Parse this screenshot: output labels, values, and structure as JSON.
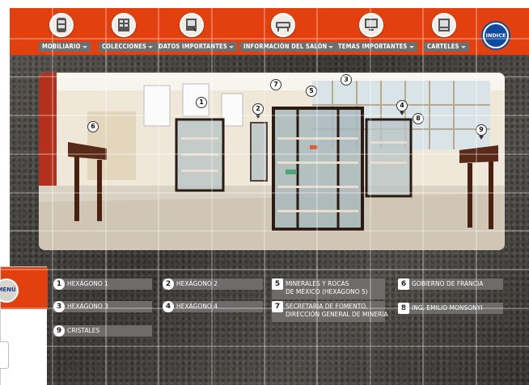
{
  "nav": {
    "items": [
      {
        "label": "MOBILIARIO",
        "icon": "cabinet-icon"
      },
      {
        "label": "COLECCIONES",
        "icon": "collection-icon"
      },
      {
        "label": "DATOS IMPORTANTES",
        "icon": "document-icon"
      },
      {
        "label": "INFORMACIÓN DEL SALÓN",
        "icon": "display-case-icon"
      },
      {
        "label": "TEMAS IMPORTANTES",
        "icon": "monitor-icon"
      },
      {
        "label": "CARTELES",
        "icon": "poster-icon"
      }
    ],
    "indice_label": "INDICE"
  },
  "photo": {
    "markers": [
      "1",
      "2",
      "3",
      "4",
      "5",
      "6",
      "7",
      "8",
      "9"
    ]
  },
  "legend": {
    "items": [
      {
        "num": "1",
        "label": "HEXÁGONO 1"
      },
      {
        "num": "2",
        "label": "HEXÁGONO 2"
      },
      {
        "num": "5",
        "label": "MINERALES Y ROCAS",
        "label2": "DE MÉXICO (HEXÁGONO 5)"
      },
      {
        "num": "6",
        "label": "GOBIERNO DE FRANCIA"
      },
      {
        "num": "3",
        "label": "HEXÁGONO 3"
      },
      {
        "num": "4",
        "label": "HEXÁGONO 4"
      },
      {
        "num": "7",
        "label": "SECRETARÍA DE FOMENTO,",
        "label2": "DIRECCIÓN GENERAL DE MINERÍA"
      },
      {
        "num": "8",
        "label": "ING. EMILIO MONSONYI"
      },
      {
        "num": "9",
        "label": "CRISTALES"
      }
    ]
  },
  "side_menu": {
    "label": "MENÚ"
  },
  "colors": {
    "accent": "#e2410f",
    "label_bg": "#6e6e6e",
    "indice_bg": "#0f4aa0"
  }
}
